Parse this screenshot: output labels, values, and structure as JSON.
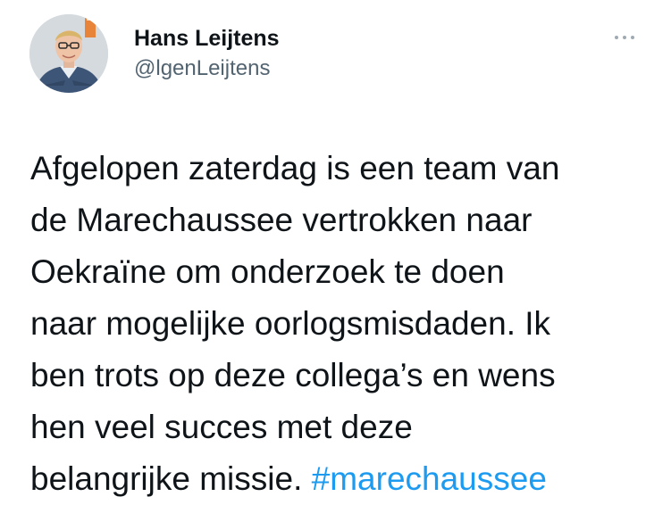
{
  "author": {
    "display_name": "Hans Leijtens",
    "handle": "@lgenLeijtens",
    "avatar_icon": "profile-photo-uniformed-man"
  },
  "more_icon": "more-options-icon",
  "tweet": {
    "lines": [
      "Afgelopen zaterdag is een team van",
      "de Marechaussee vertrokken naar",
      "Oekraïne om onderzoek te doen",
      "naar mogelijke oorlogsmisdaden. Ik",
      "ben trots op deze collega’s en wens",
      "hen veel succes met deze",
      "belangrijke missie."
    ],
    "hashtag": "#marechaussee"
  },
  "colors": {
    "text": "#0f1419",
    "secondary_text": "#536471",
    "link": "#1d9bf0",
    "background": "#ffffff"
  }
}
